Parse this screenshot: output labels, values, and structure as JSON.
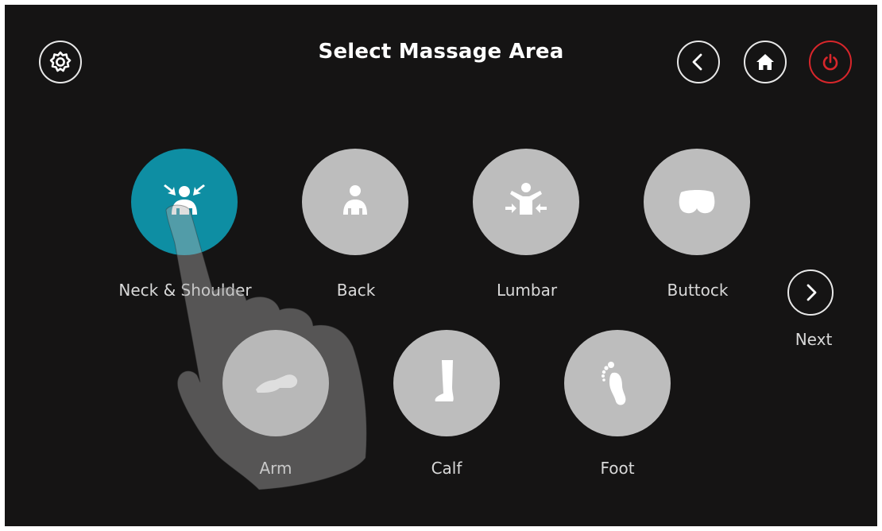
{
  "header": {
    "title": "Select Massage Area",
    "settings_icon": "gear-icon",
    "back_icon": "chevron-left-icon",
    "home_icon": "home-icon",
    "power_icon": "power-icon"
  },
  "areas": [
    {
      "label": "Neck & Shoulder",
      "icon": "neck-shoulder-icon",
      "selected": true
    },
    {
      "label": "Back",
      "icon": "back-icon",
      "selected": false
    },
    {
      "label": "Lumbar",
      "icon": "lumbar-icon",
      "selected": false
    },
    {
      "label": "Buttock",
      "icon": "buttock-icon",
      "selected": false
    },
    {
      "label": "Arm",
      "icon": "arm-icon",
      "selected": false
    },
    {
      "label": "Calf",
      "icon": "calf-icon",
      "selected": false
    },
    {
      "label": "Foot",
      "icon": "foot-icon",
      "selected": false
    }
  ],
  "next": {
    "label": "Next",
    "icon": "chevron-right-icon"
  },
  "colors": {
    "background": "#151414",
    "selected": "#0e8ea3",
    "unselected": "#bdbdbd",
    "power": "#d8262b",
    "label": "#d9d9d9"
  }
}
